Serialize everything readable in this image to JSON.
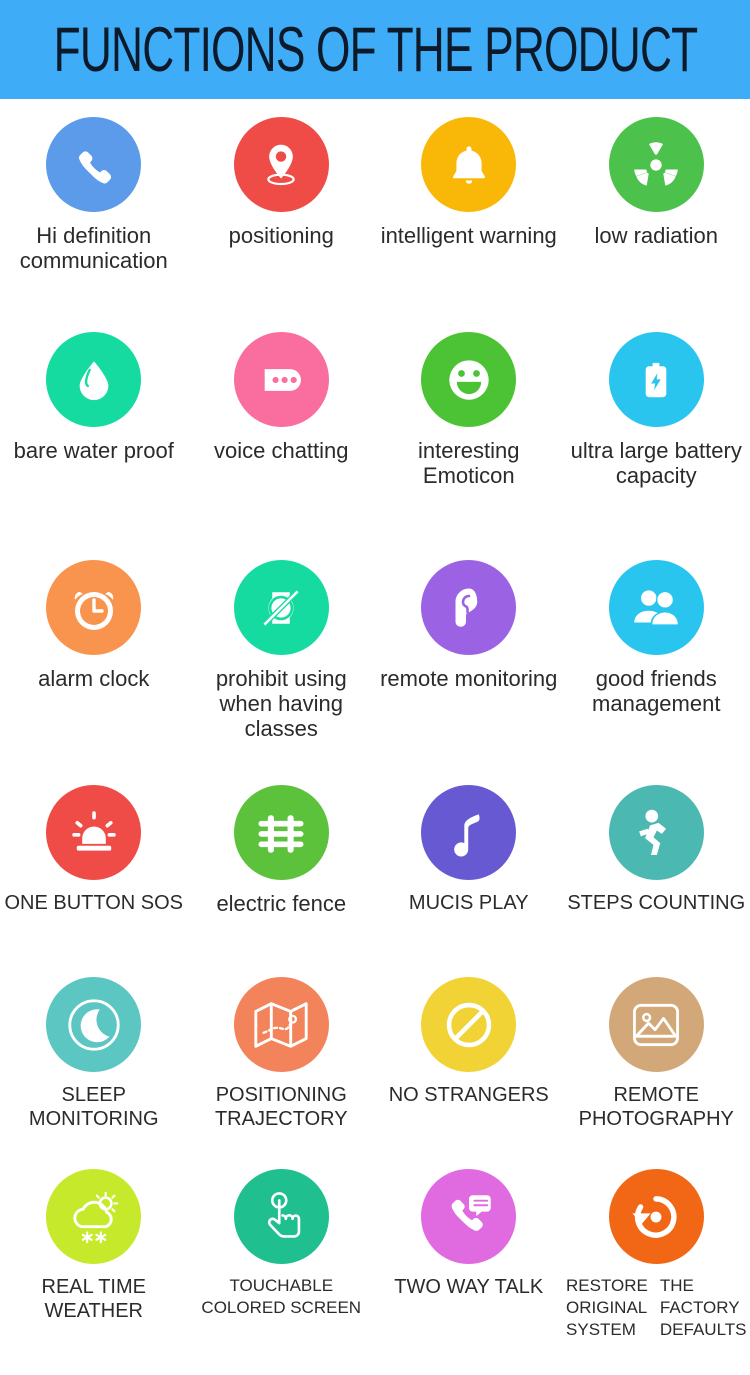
{
  "banner": {
    "title": "FUNCTIONS OF THE PRODUCT",
    "background_color": "#3FACF7",
    "text_color": "#0d1a2a"
  },
  "features": [
    [
      {
        "icon": "phone-call-icon",
        "label": "Hi definition communication",
        "color": "#5B9BEA",
        "style": "lower"
      },
      {
        "icon": "map-pin-icon",
        "label": "positioning",
        "color": "#EF4B47",
        "style": "lower"
      },
      {
        "icon": "bell-icon",
        "label": "intelligent warning",
        "color": "#F9B808",
        "style": "lower"
      },
      {
        "icon": "radiation-icon",
        "label": "low radiation",
        "color": "#4CC14C",
        "style": "lower"
      }
    ],
    [
      {
        "icon": "water-drop-icon",
        "label": "bare water proof",
        "color": "#16DBA0",
        "style": "lower"
      },
      {
        "icon": "chat-bubble-icon",
        "label": "voice chatting",
        "color": "#F96E9E",
        "style": "lower"
      },
      {
        "icon": "smiley-face-icon",
        "label": "interesting Emoticon",
        "color": "#4CC335",
        "style": "lower"
      },
      {
        "icon": "battery-charge-icon",
        "label": "ultra large battery capacity",
        "color": "#29C5EF",
        "style": "lower"
      }
    ],
    [
      {
        "icon": "alarm-clock-icon",
        "label": "alarm clock",
        "color": "#F8944E",
        "style": "lower"
      },
      {
        "icon": "no-watch-icon",
        "label": "prohibit using when having classes",
        "color": "#16DBA0",
        "style": "lower"
      },
      {
        "icon": "ear-listen-icon",
        "label": "remote monitoring",
        "color": "#9B63E3",
        "style": "lower"
      },
      {
        "icon": "two-users-icon",
        "label": "good friends management",
        "color": "#29C5EF",
        "style": "lower"
      }
    ],
    [
      {
        "icon": "siren-alarm-icon",
        "label": "ONE BUTTON SOS",
        "color": "#EF4B47",
        "style": "upper"
      },
      {
        "icon": "fence-icon",
        "label": "electric fence",
        "color": "#5CC23C",
        "style": "lower"
      },
      {
        "icon": "music-note-icon",
        "label": "MUCIS PLAY",
        "color": "#6659D2",
        "style": "upper"
      },
      {
        "icon": "running-person-icon",
        "label": "STEPS COUNTING",
        "color": "#4CB8B2",
        "style": "upper"
      }
    ],
    [
      {
        "icon": "moon-sleep-icon",
        "label": "SLEEP MONITORING",
        "color": "#5CC6C2",
        "style": "upper"
      },
      {
        "icon": "folded-map-icon",
        "label": "POSITIONING TRAJECTORY",
        "color": "#F3835B",
        "style": "upper"
      },
      {
        "icon": "prohibition-sign-icon",
        "label": "NO STRANGERS",
        "color": "#F2D335",
        "style": "upper"
      },
      {
        "icon": "photo-frame-icon",
        "label": "REMOTE PHOTOGRAPHY",
        "color": "#D3A878",
        "style": "upper"
      }
    ],
    [
      {
        "icon": "weather-cloud-sun-snow-icon",
        "label": "REAL TIME WEATHER",
        "color": "#C7E92B",
        "style": "upper"
      },
      {
        "icon": "touch-hand-icon",
        "label": "TOUCHABLE COLORED SCREEN",
        "color": "#1FBF8F",
        "style": "tiny"
      },
      {
        "icon": "phone-chat-icon",
        "label": "TWO WAY TALK",
        "color": "#E06AE0",
        "style": "upper"
      },
      {
        "icon": "restore-reset-icon",
        "label": "RESTORE THE ORIGINAL FACTORY SYSTEM DEFAULTS",
        "color": "#F26716",
        "style": "restore",
        "restore_lines": [
          [
            "RESTORE",
            "THE"
          ],
          [
            "ORIGINAL",
            "FACTORY"
          ],
          [
            "SYSTEM",
            "DEFAULTS"
          ]
        ]
      }
    ]
  ]
}
